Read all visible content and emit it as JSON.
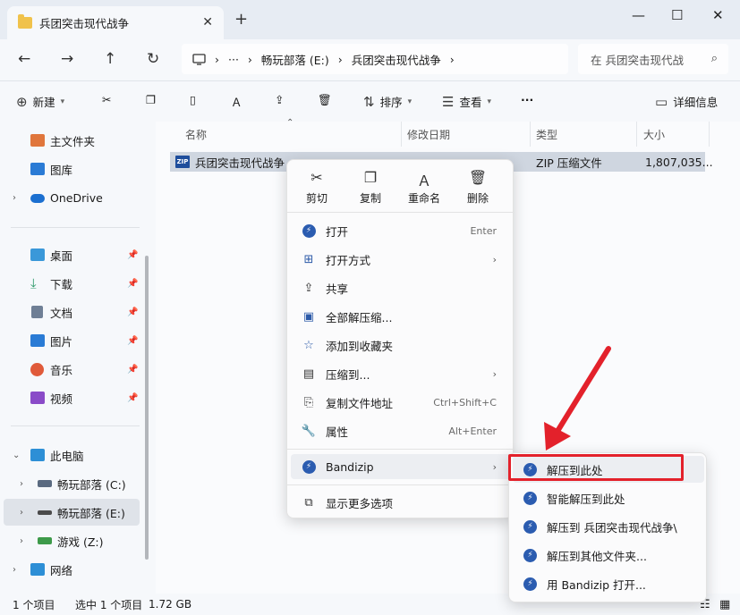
{
  "window": {
    "tab_title": "兵团突击现代战争",
    "new_tab": "+",
    "close": "✕",
    "minimize": "—",
    "maximize": "☐"
  },
  "address": {
    "more": "···",
    "crumbs": [
      "畅玩部落 (E:)",
      "兵团突击现代战争"
    ],
    "search_placeholder": "在 兵团突击现代战"
  },
  "toolbar": {
    "new": "新建",
    "sort": "排序",
    "view": "查看",
    "more": "···",
    "details": "详细信息"
  },
  "sidebar": {
    "items": [
      {
        "label": "主文件夹",
        "icon": "home-icon",
        "color": "#e0763c"
      },
      {
        "label": "图库",
        "icon": "gallery-icon",
        "color": "#2a7bd5"
      },
      {
        "label": "OneDrive",
        "icon": "cloud-icon",
        "color": "#1b6fd0"
      },
      {
        "label": "桌面",
        "icon": "desktop-icon",
        "color": "#3a98d9"
      },
      {
        "label": "下载",
        "icon": "download-icon",
        "color": "#2e9a6a"
      },
      {
        "label": "文档",
        "icon": "document-icon",
        "color": "#6f7f95"
      },
      {
        "label": "图片",
        "icon": "pictures-icon",
        "color": "#2a7bd5"
      },
      {
        "label": "音乐",
        "icon": "music-icon",
        "color": "#e05a3a"
      },
      {
        "label": "视频",
        "icon": "video-icon",
        "color": "#8a4bc8"
      },
      {
        "label": "此电脑",
        "icon": "computer-icon",
        "color": "#2d8fd6"
      },
      {
        "label": "畅玩部落 (C:)",
        "icon": "drive-icon",
        "color": "#5a6a80"
      },
      {
        "label": "畅玩部落 (E:)",
        "icon": "drive-icon",
        "color": "#4a4a4a"
      },
      {
        "label": "游戏 (Z:)",
        "icon": "drive-icon",
        "color": "#3d9a4a"
      },
      {
        "label": "网络",
        "icon": "network-icon",
        "color": "#2d8fd6"
      }
    ]
  },
  "columns": {
    "name": "名称",
    "date": "修改日期",
    "type": "类型",
    "size": "大小"
  },
  "file": {
    "icon_text": "ZIP",
    "name": "兵团突击现代战争",
    "type": "ZIP 压缩文件",
    "size": "1,807,035..."
  },
  "context_menu": {
    "quick": [
      "剪切",
      "复制",
      "重命名",
      "删除"
    ],
    "items": [
      {
        "label": "打开",
        "shortcut": "Enter"
      },
      {
        "label": "打开方式",
        "shortcut": ""
      },
      {
        "label": "共享",
        "shortcut": ""
      },
      {
        "label": "全部解压缩...",
        "shortcut": ""
      },
      {
        "label": "添加到收藏夹",
        "shortcut": ""
      },
      {
        "label": "压缩到...",
        "shortcut": ""
      },
      {
        "label": "复制文件地址",
        "shortcut": "Ctrl+Shift+C"
      },
      {
        "label": "属性",
        "shortcut": "Alt+Enter"
      },
      {
        "label": "Bandizip",
        "shortcut": ""
      },
      {
        "label": "显示更多选项",
        "shortcut": ""
      }
    ]
  },
  "submenu": {
    "items": [
      "解压到此处",
      "智能解压到此处",
      "解压到 兵团突击现代战争\\",
      "解压到其他文件夹...",
      "用 Bandizip 打开..."
    ]
  },
  "status": {
    "count": "1 个项目",
    "selected": "选中 1 个项目",
    "size": "1.72 GB"
  },
  "colors": {
    "highlight_box": "#e3212b",
    "arrow": "#e3212b",
    "bandizip": "#2b5cb0"
  }
}
